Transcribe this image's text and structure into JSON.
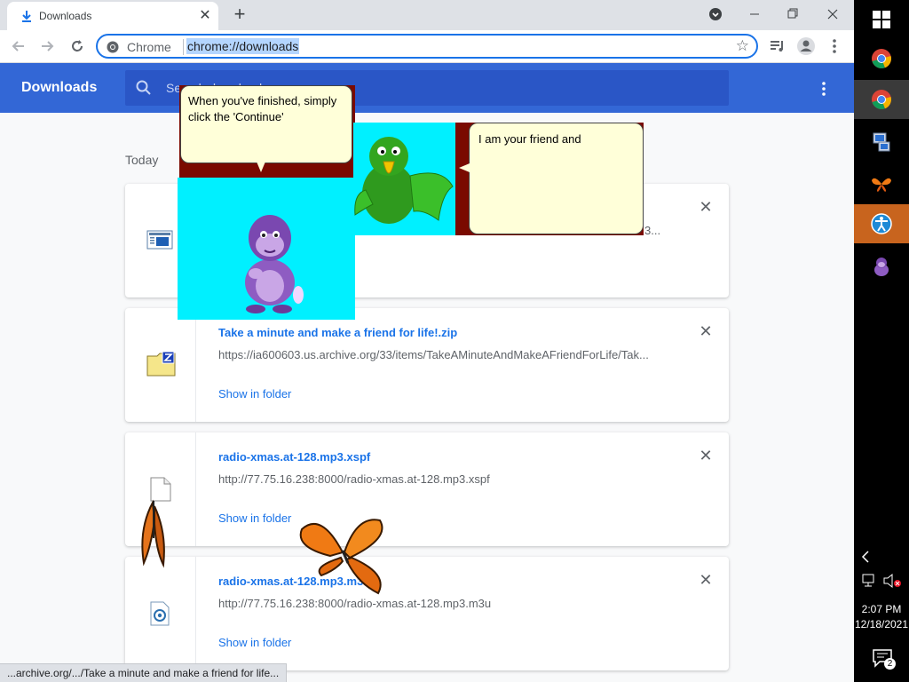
{
  "browser": {
    "tab_title": "Downloads",
    "tab_close": "✕",
    "new_tab": "+",
    "omnibox_scheme": "Chrome",
    "omnibox_url": "chrome://downloads"
  },
  "header": {
    "title": "Downloads",
    "search_placeholder": "Search downloads"
  },
  "content": {
    "section_label": "Today",
    "items": [
      {
        "name": "",
        "url_tail": "3...",
        "show_in_folder": "",
        "icon": "document-icon"
      },
      {
        "name": "Take a minute and make a friend for life!.zip",
        "url": "https://ia600603.us.archive.org/33/items/TakeAMinuteAndMakeAFriendForLife/Tak...",
        "show_in_folder": "Show in folder",
        "icon": "zip-file-icon"
      },
      {
        "name": "radio-xmas.at-128.mp3.xspf",
        "url": "http://77.75.16.238:8000/radio-xmas.at-128.mp3.xspf",
        "show_in_folder": "Show in folder",
        "icon": "blank-file-icon"
      },
      {
        "name": "radio-xmas.at-128.mp3.m3u",
        "url": "http://77.75.16.238:8000/radio-xmas.at-128.mp3.m3u",
        "show_in_folder": "Show in folder",
        "icon": "playlist-file-icon"
      }
    ]
  },
  "status_bar": "...archive.org/.../Take a minute and make a friend for life...",
  "overlays": {
    "bubble1": "When you've finished, simply click the 'Continue'",
    "bubble2": "I am your friend and"
  },
  "taskbar": {
    "time": "2:07 PM",
    "date": "12/18/2021",
    "notification_count": "2"
  },
  "colors": {
    "header_blue": "#3367d6",
    "link_blue": "#1a73e8",
    "overlay_cyan": "#00f0ff",
    "overlay_maroon": "#7a0a00",
    "bubble_yellow": "#ffffd9",
    "taskbar_accent": "#c8641e"
  }
}
